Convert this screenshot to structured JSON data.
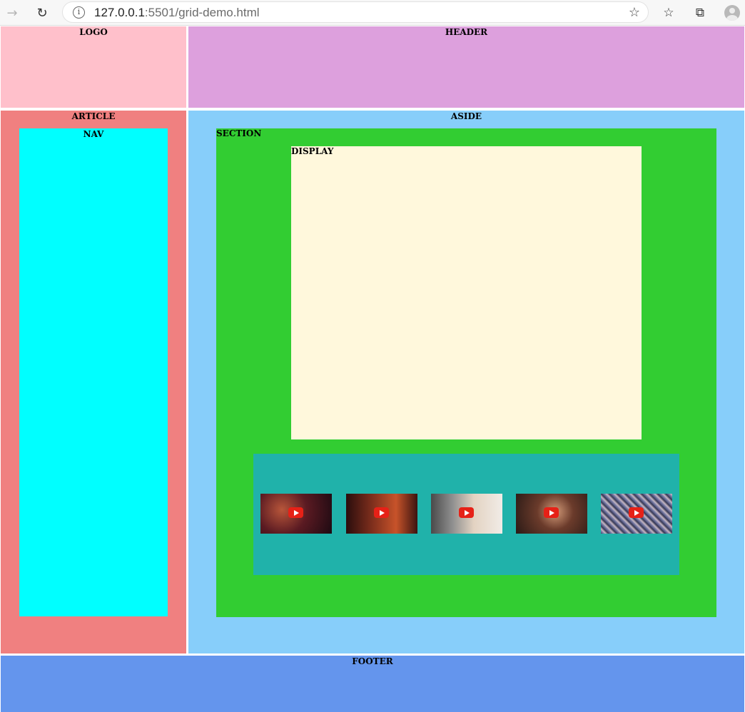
{
  "browser": {
    "url_host": "127.0.0.1",
    "url_rest": ":5501/grid-demo.html"
  },
  "regions": {
    "logo": "LOGO",
    "header": "HEADER",
    "article": "ARTICLE",
    "nav": "NAV",
    "aside": "ASIDE",
    "section": "SECTION",
    "display": "DISPLAY",
    "footer": "FOOTER"
  },
  "colors": {
    "logo": "#ffc0cb",
    "header": "#dda0dd",
    "article": "#f08080",
    "nav": "#00ffff",
    "aside": "#87cefa",
    "section": "#32cd32",
    "display": "#fff8dc",
    "videos": "#20b2aa",
    "footer": "#6495ed"
  },
  "videos": [
    {
      "icon": "play-icon"
    },
    {
      "icon": "play-icon"
    },
    {
      "icon": "play-icon"
    },
    {
      "icon": "play-icon"
    },
    {
      "icon": "play-icon"
    }
  ]
}
